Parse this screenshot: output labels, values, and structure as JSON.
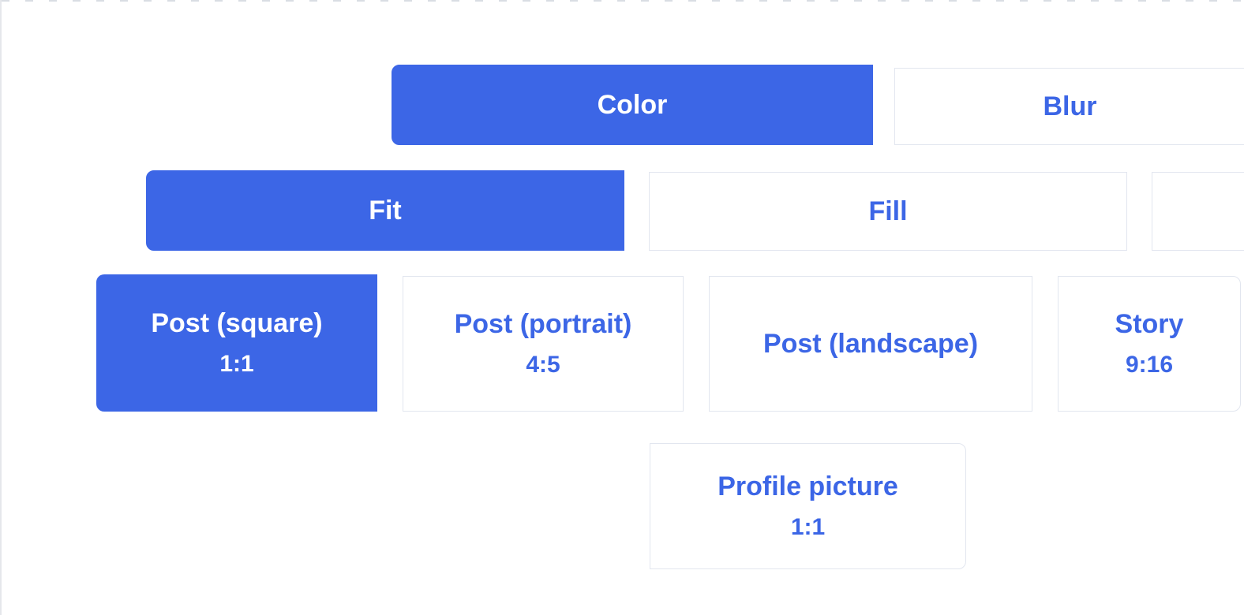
{
  "colors": {
    "accent": "#3c66e6"
  },
  "background_mode": {
    "color_label": "Color",
    "blur_label": "Blur",
    "selected": "color"
  },
  "fit_mode": {
    "fit_label": "Fit",
    "fill_label": "Fill",
    "selected": "fit"
  },
  "aspect_presets": {
    "selected": "post-square",
    "post_square": {
      "label": "Post (square)",
      "ratio": "1:1"
    },
    "post_portrait": {
      "label": "Post (portrait)",
      "ratio": "4:5"
    },
    "post_landscape": {
      "label": "Post (landscape)",
      "ratio": ""
    },
    "story": {
      "label": "Story",
      "ratio": "9:16"
    },
    "profile": {
      "label": "Profile picture",
      "ratio": "1:1"
    }
  }
}
